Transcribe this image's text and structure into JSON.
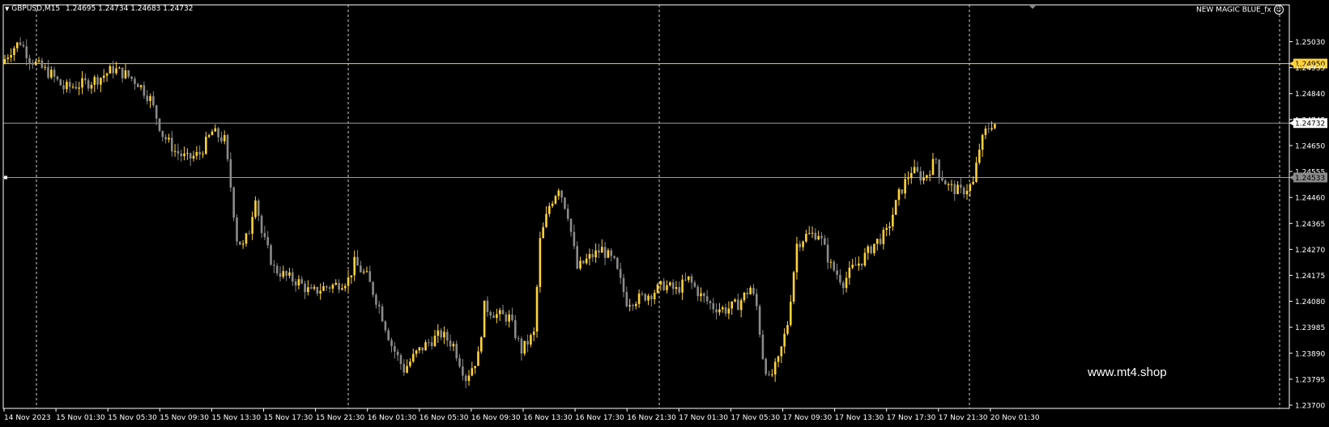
{
  "header": {
    "symbol": "GBPUSD,M15",
    "ohlc": "1.24695 1.24734 1.24683 1.24732",
    "indicator": "NEW MAGIC BLUE_fx"
  },
  "watermark": "www.mt4.shop",
  "colors": {
    "background": "#000000",
    "bull": "#ffd23a",
    "bear": "#8a8a8a",
    "axis": "#ffffff",
    "resistance": "#ffd23a",
    "level": "#9a9a9a"
  },
  "price_axis": [
    "1.25030",
    "1.24950",
    "1.24935",
    "1.24840",
    "1.24745",
    "1.24732",
    "1.24650",
    "1.24555",
    "1.24533",
    "1.24460",
    "1.24365",
    "1.24270",
    "1.24175",
    "1.24080",
    "1.23985",
    "1.23890",
    "1.23795",
    "1.23700"
  ],
  "time_axis": [
    "14 Nov 2023",
    "15 Nov 01:30",
    "15 Nov 05:30",
    "15 Nov 09:30",
    "15 Nov 13:30",
    "15 Nov 17:30",
    "15 Nov 21:30",
    "16 Nov 01:30",
    "16 Nov 05:30",
    "16 Nov 09:30",
    "16 Nov 13:30",
    "16 Nov 17:30",
    "16 Nov 21:30",
    "17 Nov 01:30",
    "17 Nov 05:30",
    "17 Nov 09:30",
    "17 Nov 13:30",
    "17 Nov 17:30",
    "17 Nov 21:30",
    "20 Nov 01:30"
  ],
  "levels": {
    "resistance": "1.24950",
    "current": "1.24732",
    "support": "1.24533"
  },
  "chart_data": {
    "type": "candlestick",
    "symbol": "GBPUSD",
    "timeframe": "M15",
    "ylim": [
      1.237,
      1.2508
    ],
    "day_separators": [
      "14 Nov 2023",
      "15 Nov 21:30",
      "16 Nov 21:30",
      "17 Nov 21:30",
      "20 Nov 01:30"
    ],
    "path_anchors": [
      [
        0,
        1.2495
      ],
      [
        3,
        1.25
      ],
      [
        6,
        1.2503
      ],
      [
        9,
        1.2497
      ],
      [
        12,
        1.2494
      ],
      [
        16,
        1.2491
      ],
      [
        20,
        1.2486
      ],
      [
        24,
        1.2487
      ],
      [
        28,
        1.2488
      ],
      [
        32,
        1.249
      ],
      [
        36,
        1.2493
      ],
      [
        40,
        1.2491
      ],
      [
        44,
        1.2488
      ],
      [
        48,
        1.2482
      ],
      [
        52,
        1.2469
      ],
      [
        56,
        1.2463
      ],
      [
        60,
        1.246
      ],
      [
        64,
        1.2462
      ],
      [
        68,
        1.247
      ],
      [
        72,
        1.2467
      ],
      [
        74,
        1.245
      ],
      [
        76,
        1.2431
      ],
      [
        78,
        1.2428
      ],
      [
        80,
        1.2434
      ],
      [
        82,
        1.2447
      ],
      [
        84,
        1.2433
      ],
      [
        88,
        1.242
      ],
      [
        92,
        1.2417
      ],
      [
        96,
        1.2415
      ],
      [
        100,
        1.2411
      ],
      [
        104,
        1.2413
      ],
      [
        108,
        1.2414
      ],
      [
        112,
        1.2416
      ],
      [
        114,
        1.2422
      ],
      [
        118,
        1.2417
      ],
      [
        122,
        1.2406
      ],
      [
        126,
        1.2392
      ],
      [
        130,
        1.2383
      ],
      [
        134,
        1.2389
      ],
      [
        138,
        1.2393
      ],
      [
        142,
        1.2396
      ],
      [
        146,
        1.2392
      ],
      [
        150,
        1.238
      ],
      [
        154,
        1.2388
      ],
      [
        156,
        1.2406
      ],
      [
        160,
        1.2403
      ],
      [
        164,
        1.2402
      ],
      [
        168,
        1.239
      ],
      [
        172,
        1.2396
      ],
      [
        174,
        1.243
      ],
      [
        177,
        1.2443
      ],
      [
        180,
        1.245
      ],
      [
        183,
        1.244
      ],
      [
        186,
        1.242
      ],
      [
        190,
        1.2424
      ],
      [
        194,
        1.2427
      ],
      [
        198,
        1.2422
      ],
      [
        202,
        1.2408
      ],
      [
        206,
        1.2409
      ],
      [
        210,
        1.2411
      ],
      [
        214,
        1.2414
      ],
      [
        218,
        1.2412
      ],
      [
        222,
        1.2416
      ],
      [
        226,
        1.241
      ],
      [
        230,
        1.2406
      ],
      [
        234,
        1.2405
      ],
      [
        238,
        1.2407
      ],
      [
        242,
        1.2413
      ],
      [
        244,
        1.2406
      ],
      [
        246,
        1.2388
      ],
      [
        248,
        1.2379
      ],
      [
        251,
        1.2386
      ],
      [
        254,
        1.24
      ],
      [
        257,
        1.2429
      ],
      [
        260,
        1.2432
      ],
      [
        264,
        1.2433
      ],
      [
        268,
        1.2421
      ],
      [
        272,
        1.2415
      ],
      [
        275,
        1.242
      ],
      [
        278,
        1.2423
      ],
      [
        282,
        1.2429
      ],
      [
        286,
        1.2433
      ],
      [
        290,
        1.2447
      ],
      [
        294,
        1.2456
      ],
      [
        298,
        1.2453
      ],
      [
        302,
        1.246
      ],
      [
        303,
        1.2455
      ],
      [
        306,
        1.245
      ],
      [
        310,
        1.2448
      ],
      [
        314,
        1.2451
      ],
      [
        316,
        1.2464
      ],
      [
        318,
        1.247
      ],
      [
        320,
        1.2473
      ]
    ]
  }
}
